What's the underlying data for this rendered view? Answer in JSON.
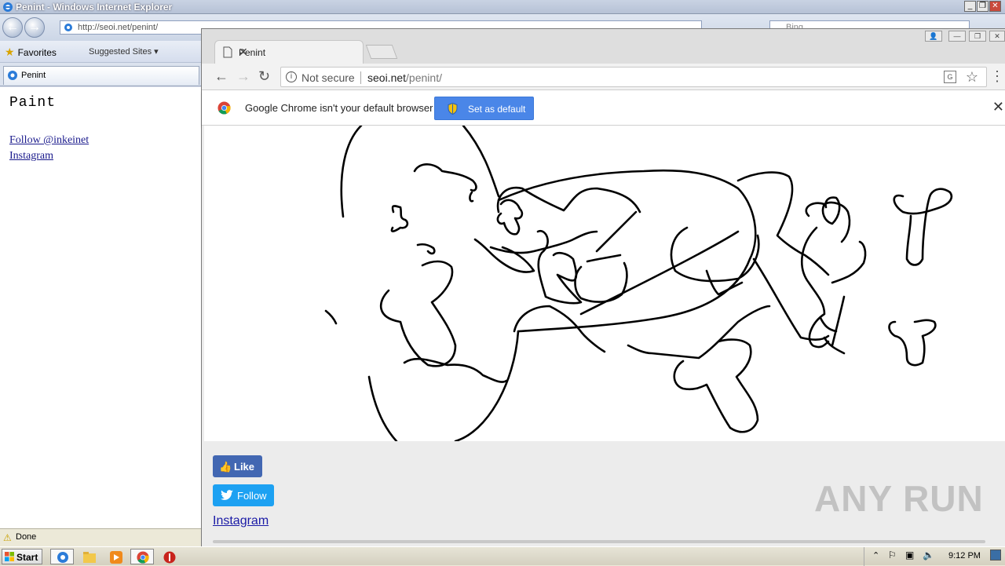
{
  "ie": {
    "title": "Penint - Windows Internet Explorer",
    "address": "http://seoi.net/penint/",
    "search_placeholder": "Bing",
    "favorites_label": "Favorites",
    "suggested_sites": "Suggested Sites",
    "tab_label": "Penint",
    "page_title": "Paint",
    "link_follow": "Follow @inkeinet",
    "link_instagram": "Instagram",
    "status": "Done"
  },
  "chrome": {
    "tab_label": "Penint",
    "security_label": "Not secure",
    "url_domain": "seoi.net",
    "url_path": "/penint/",
    "infobar_message": "Google Chrome isn't your default browser",
    "infobar_button": "Set as default",
    "like_label": "Like",
    "follow_label": "Follow",
    "instagram_label": "Instagram",
    "watermark": "ANY RUN"
  },
  "taskbar": {
    "start_label": "Start",
    "clock": "9:12 PM"
  },
  "colors": {
    "facebook_blue": "#4267b2",
    "twitter_blue": "#1da1f2",
    "chrome_button_blue": "#4a86e8",
    "link_blue": "#1a1aa6"
  }
}
